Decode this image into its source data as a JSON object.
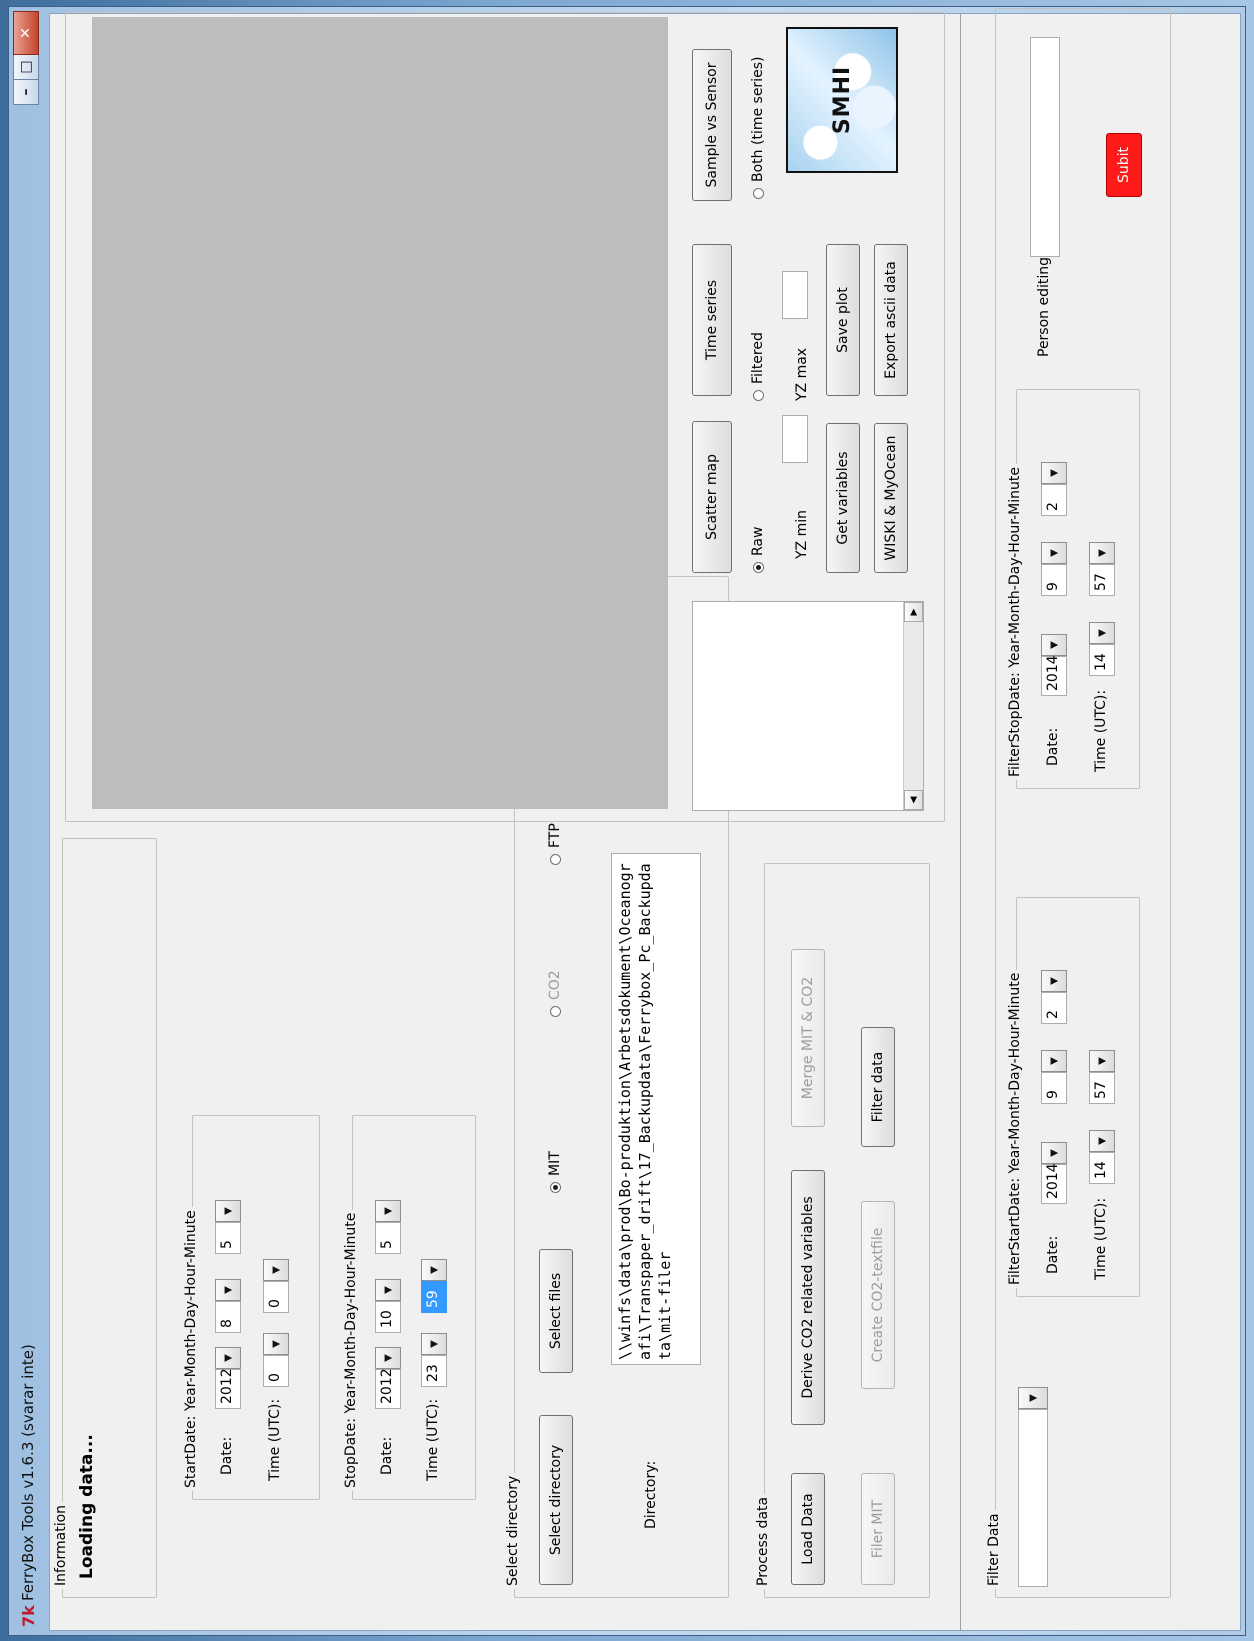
{
  "window": {
    "title": "FerryBox Tools  v1.6.3 (svarar inte)",
    "app_icon": "tk-feather-icon",
    "minimize_glyph": "–",
    "maximize_glyph": "□",
    "close_glyph": "✕"
  },
  "information": {
    "group_label": "Information",
    "status_text": "Loading data..."
  },
  "start_date": {
    "group_label": "StartDate: Year-Month-Day-Hour-Minute",
    "date_label": "Date:",
    "time_label": "Time (UTC):",
    "year": "2012",
    "month": "8",
    "day": "5",
    "hour": "0",
    "minute": "0"
  },
  "stop_date": {
    "group_label": "StopDate: Year-Month-Day-Hour-Minute",
    "date_label": "Date:",
    "time_label": "Time (UTC):",
    "year": "2012",
    "month": "10",
    "day": "5",
    "hour": "23",
    "minute": "59"
  },
  "select_directory": {
    "group_label": "Select directory",
    "select_directory_button": "Select directory",
    "select_files_button": "Select files",
    "radio_mit": "MIT",
    "radio_co2": "CO2",
    "radio_ftp": "FTP",
    "directory_label": "Directory:",
    "directory_value": "\\\\winfs\\data\\prod\\Bo-produktion\\Arbetsdokument\\Oceanografi\\Transpaper_drift\\17_Backupdata\\Ferrybox_Pc_Backupdata\\mit-filer"
  },
  "process_data": {
    "group_label": "Process data",
    "load_data": "Load Data",
    "derive_co2": "Derive CO2 related variables",
    "merge_mit_co2": "Merge MIT & CO2",
    "filer_mit": "Filer MIT",
    "create_co2_textfile": "Create CO2-textfile",
    "filter_data": "Filter data"
  },
  "plot_controls": {
    "scatter_map": "Scatter map",
    "time_series": "Time series",
    "sample_vs_sensor": "Sample vs Sensor",
    "radio_raw": "Raw",
    "radio_filtered": "Filtered",
    "radio_both": "Both (time series)",
    "yz_min_label": "YZ min",
    "yz_max_label": "YZ max",
    "get_variables": "Get variables",
    "save_plot": "Save plot",
    "wiski_myocean": "WISKI & MyOcean",
    "export_ascii": "Export ascii data",
    "logo_text": "SMHI"
  },
  "filter_data": {
    "group_label": "Filter Data",
    "filter_start": {
      "group_label": "FilterStartDate: Year-Month-Day-Hour-Minute",
      "date_label": "Date:",
      "time_label": "Time (UTC):",
      "year": "2014",
      "month": "9",
      "day": "2",
      "hour": "14",
      "minute": "57"
    },
    "filter_stop": {
      "group_label": "FilterStopDate: Year-Month-Day-Hour-Minute",
      "date_label": "Date:",
      "time_label": "Time (UTC):",
      "year": "2014",
      "month": "9",
      "day": "2",
      "hour": "14",
      "minute": "57"
    },
    "person_editing_label": "Person editing:",
    "submit_button": "Subit"
  },
  "colors": {
    "submit_red": "#ff1a1a",
    "selected_minute_highlight": "#3399ff",
    "plot_area_gray": "#bdbdbd",
    "close_button_red": "#c3442d"
  }
}
